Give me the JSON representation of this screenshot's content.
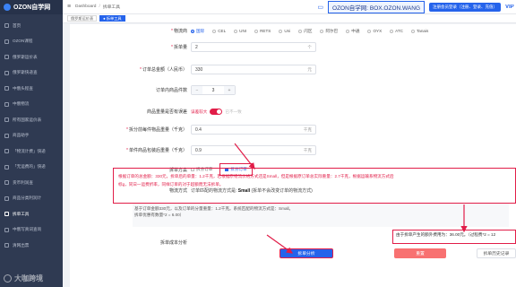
{
  "app": {
    "brand": "OZON自学网",
    "watermark": "大咖跨境"
  },
  "sidebar": {
    "items": [
      {
        "label": "首页"
      },
      {
        "label": "OZON课程"
      },
      {
        "label": "俄罗斯运价表"
      },
      {
        "label": "俄罗斯快递查"
      },
      {
        "label": "中俄头程查"
      },
      {
        "label": "中俄物流"
      },
      {
        "label": "所有国家运价表"
      },
      {
        "label": "商品助手"
      },
      {
        "label": "「物流计费」快递"
      },
      {
        "label": "「无运费的」快递"
      },
      {
        "label": "货币利润查"
      },
      {
        "label": "商品分类利润计"
      },
      {
        "label": "拆单工具"
      },
      {
        "label": "中俄写真词查询"
      },
      {
        "label": "清网出票"
      }
    ],
    "active_index": 12
  },
  "topbar": {
    "breadcrumb": [
      "Dashboard",
      "拆单工具"
    ],
    "banner": "OZON自学网: BOX.OZON.WANG",
    "register_btn": "注册会员登录（注册、登录、充值）",
    "vip": "VIP"
  },
  "tabs": [
    {
      "label": "俄罗斯运价表"
    },
    {
      "label": "● 拆单工具"
    }
  ],
  "form": {
    "logistics_label": "物流商",
    "logistics_options": [
      "国际",
      "CEL",
      "UNI",
      "RETS",
      "Uni",
      "闪区",
      "阿尔巴",
      "中通",
      "OYX",
      "ATC",
      "Tanais"
    ],
    "logistics_selected": 0,
    "split_count_label": "拆单量",
    "split_count_value": "2",
    "split_count_unit": "个",
    "order_amount_label": "订单总金额（人民币）",
    "order_amount_value": "330",
    "order_amount_unit": "元",
    "items_per_order_label": "订单内商品件数",
    "items_per_order_value": "3",
    "stepper_minus": "−",
    "stepper_plus": "+",
    "weight_mode_label": "商品重量是否有误差",
    "toggle_on_label": "误差较大",
    "toggle_off_label": "已不一致",
    "all_weight_label": "拆分前每件物品重量（千克）",
    "all_weight_value": "0.4",
    "all_weight_unit": "千克",
    "single_weight_label": "单件商品包装后重量（千克）",
    "single_weight_value": "0.9",
    "single_weight_unit": "千克",
    "split_mode_label": "拆单方案",
    "split_mode_options": [
      "拆分订单",
      "拆分订单"
    ],
    "split_mode_selected": 1
  },
  "result": {
    "shipping_label": "物流方式",
    "shipping_text": "订单匹配的物流方式是:",
    "shipping_value": "Small",
    "shipping_note": "(拆单不会改变订单的物流方式)",
    "advice_label": "拆单建议",
    "advice_text_1": "根据订单的总金额：330元，拆单后的单量：1.2千克，若根据原物流价格方式还是Small，但是根据原订单总实际重量：2.7千克，根据运输系物流方式后",
    "advice_text_2": "标g，同日一运费折率，同样订单的对于超额而无法拆单。",
    "analysis_label": "拆单成本分析",
    "analysis_text_1": "基于订单金额330元，以及订单的分量重量：1.2千克。系统匹配的物流方式是：Small。",
    "analysis_text_2": "拆单优惠有数量*2 = 6.00）",
    "highlight_text": "由于拆单产生的额外费用为：36.00元。（过程费*2 = 12"
  },
  "buttons": {
    "analyze": "拆单分析",
    "reset": "重置",
    "history": "拆单历史记录"
  }
}
